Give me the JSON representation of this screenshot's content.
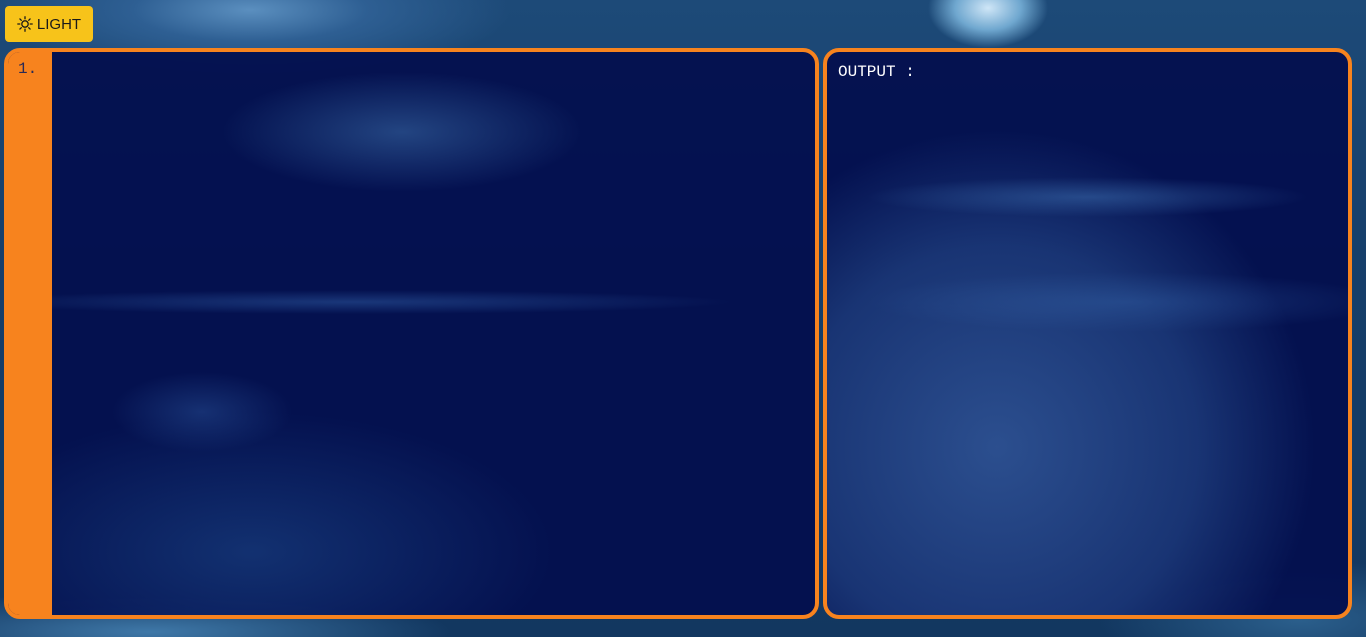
{
  "theme_toggle": {
    "label": "LIGHT",
    "icon": "sun-icon",
    "color": "#f7c31a"
  },
  "editor": {
    "line_numbers": [
      "1."
    ],
    "code": "",
    "accent_color": "#f7831e"
  },
  "output": {
    "label": "OUTPUT :",
    "content": ""
  }
}
